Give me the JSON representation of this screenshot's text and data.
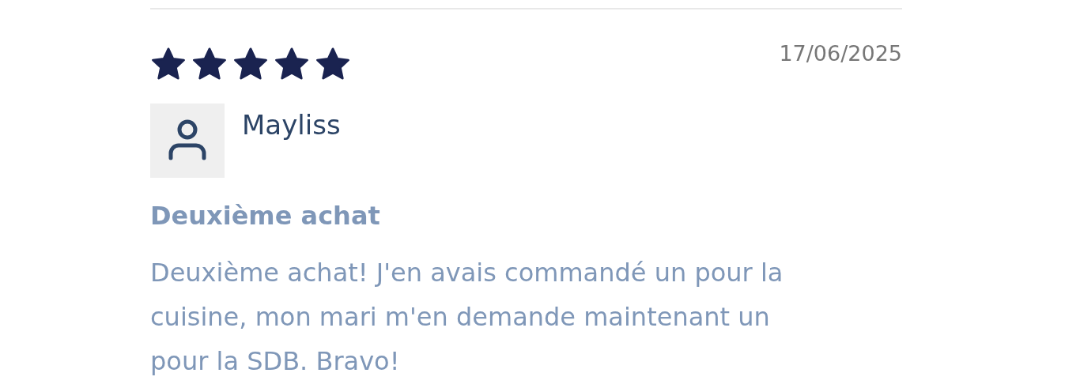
{
  "review": {
    "stars": 5,
    "date": "17/06/2025",
    "author": "Mayliss",
    "title": "Deuxième achat",
    "body": "Deuxième achat! J'en avais commandé un pour la cuisine, mon mari m'en demande maintenant un pour la SDB. Bravo!"
  }
}
